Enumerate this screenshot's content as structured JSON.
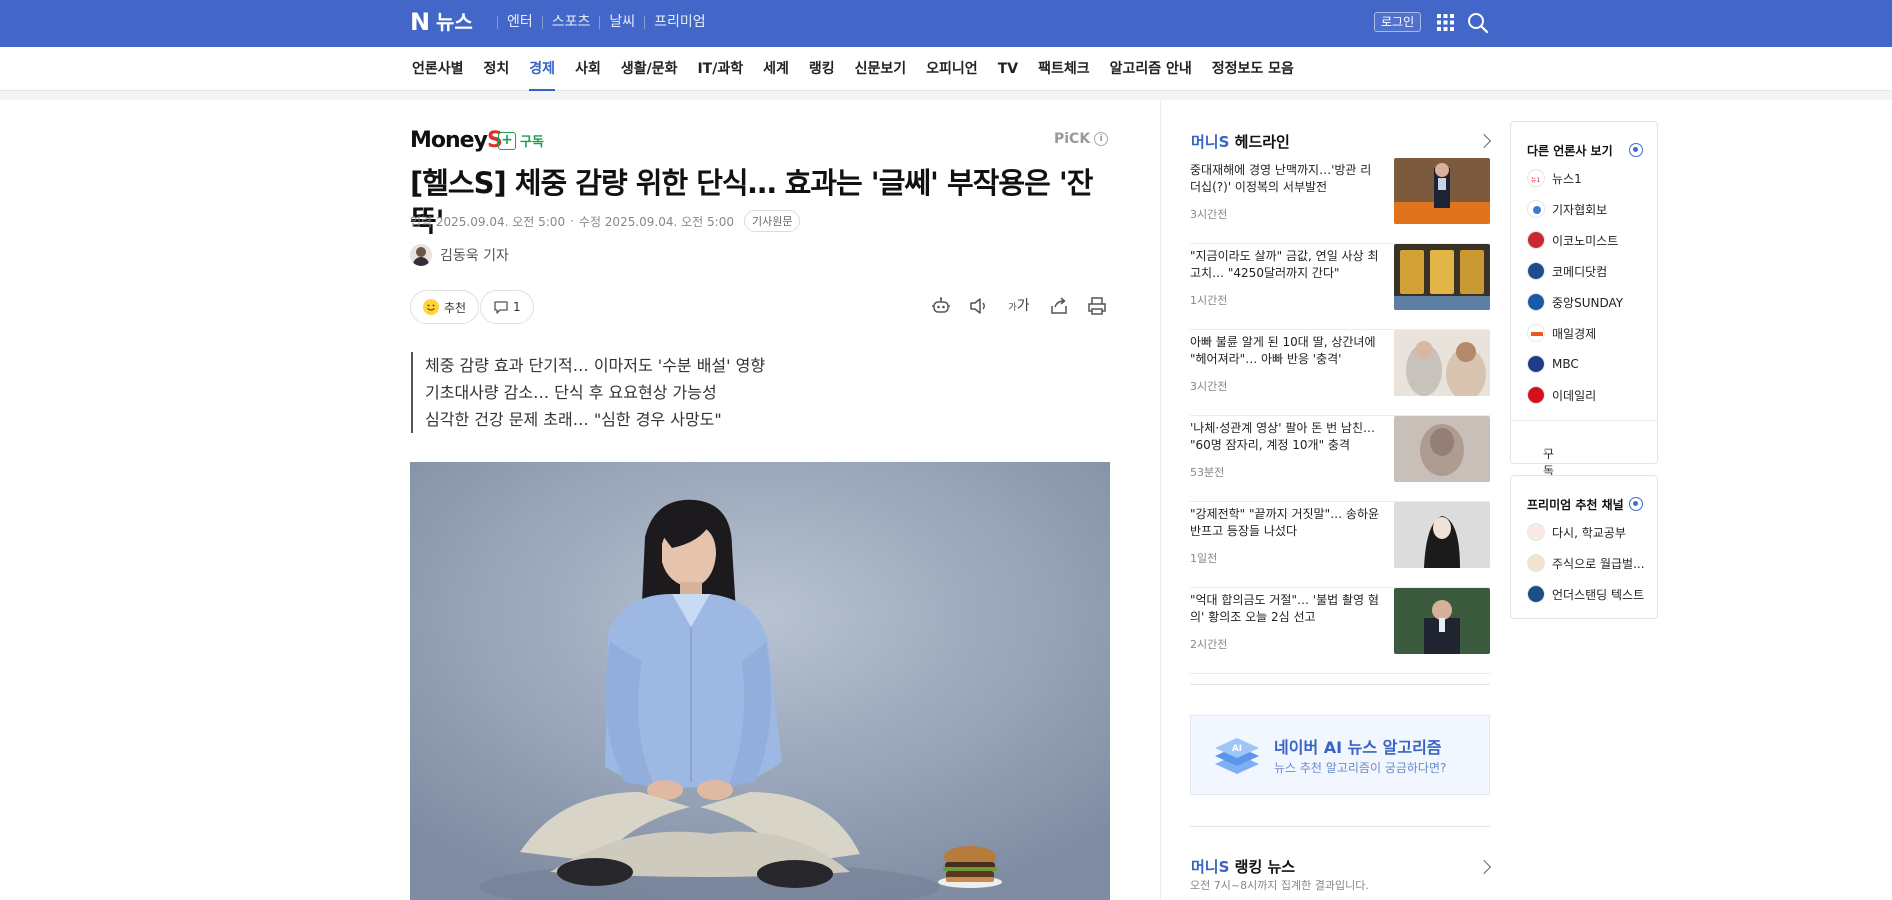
{
  "topbar": {
    "logo_letter": "N",
    "logo_text": "뉴스",
    "nav": [
      "엔터",
      "스포츠",
      "날씨",
      "프리미엄"
    ],
    "login_label": "로그인"
  },
  "categories": [
    "언론사별",
    "정치",
    "경제",
    "사회",
    "생활/문화",
    "IT/과학",
    "세계",
    "랭킹",
    "신문보기",
    "오피니언",
    "TV",
    "팩트체크",
    "알고리즘 안내",
    "정정보도 모음"
  ],
  "active_category": "경제",
  "article": {
    "press_name": "Money",
    "press_name_suffix": "S",
    "subscribe_label": "구독",
    "pick_label": "PiCK",
    "headline": "[헬스S] 체중 감량 위한 단식… 효과는 '글쎄' 부작용은 '잔뜩'",
    "input_date": "입력 2025.09.04. 오전 5:00",
    "modify_date": "수정 2025.09.04. 오전 5:00",
    "source_label": "기사원문",
    "reporter": "김동욱 기자",
    "like_label": "추천",
    "comment_count": "1",
    "font_size_label": "가",
    "summary": [
      "체중 감량 효과 단기적… 이마저도 '수분 배설' 영향",
      "기초대사량 감소… 단식 후 요요현상 가능성",
      "심각한 건강 문제 초래… \"심한 경우 사망도\""
    ]
  },
  "headlines": {
    "press": "머니S",
    "title": "헤드라인",
    "items": [
      {
        "text": "중대재해에 경영 난맥까지…'방관 리더십(?)' 이정복의 서부발전",
        "time": "3시간전"
      },
      {
        "text": "\"지금이라도 살까\" 금값, 연일 사상 최고치… \"4250달러까지 간다\"",
        "time": "1시간전"
      },
      {
        "text": "아빠 불륜 알게 된 10대 딸, 상간녀에 \"헤어져라\"… 아빠 반응 '충격'",
        "time": "3시간전"
      },
      {
        "text": "'나체·성관계 영상' 팔아 돈 번 남친… \"60명 잠자리, 계정 10개\" 충격",
        "time": "53분전"
      },
      {
        "text": "\"강제전학\" \"끝까지 거짓말\"… 송하윤 반프고 등장들 나섰다",
        "time": "1일전"
      },
      {
        "text": "\"억대 합의금도 거절\"… '불법 촬영 혐의' 황의조 오늘 2심 선고",
        "time": "2시간전"
      }
    ]
  },
  "ai_banner": {
    "title": "네이버 AI 뉴스 알고리즘",
    "subtitle": "뉴스 추천 알고리즘이 궁금하다면?"
  },
  "ranking": {
    "press": "머니S",
    "title": "랭킹 뉴스",
    "note": "오전 7시~8시까지 집계한 결과입니다."
  },
  "other_press": {
    "title": "다른 언론사 보기",
    "items": [
      "뉴스1",
      "기자협회보",
      "이코노미스트",
      "코메디닷컴",
      "중앙SUNDAY",
      "매일경제",
      "MBC",
      "이데일리"
    ],
    "footer": "구독 설정"
  },
  "premium": {
    "title": "프리미엄 추천 채널",
    "items": [
      "다시, 학교공부",
      "주식으로 월급벌...",
      "언더스탠딩 텍스트"
    ]
  },
  "colors": {
    "brand_blue": "#4267c8",
    "accent": "#3663c4",
    "press_red": "#e0312b",
    "subscribe_green": "#1fa04b"
  }
}
